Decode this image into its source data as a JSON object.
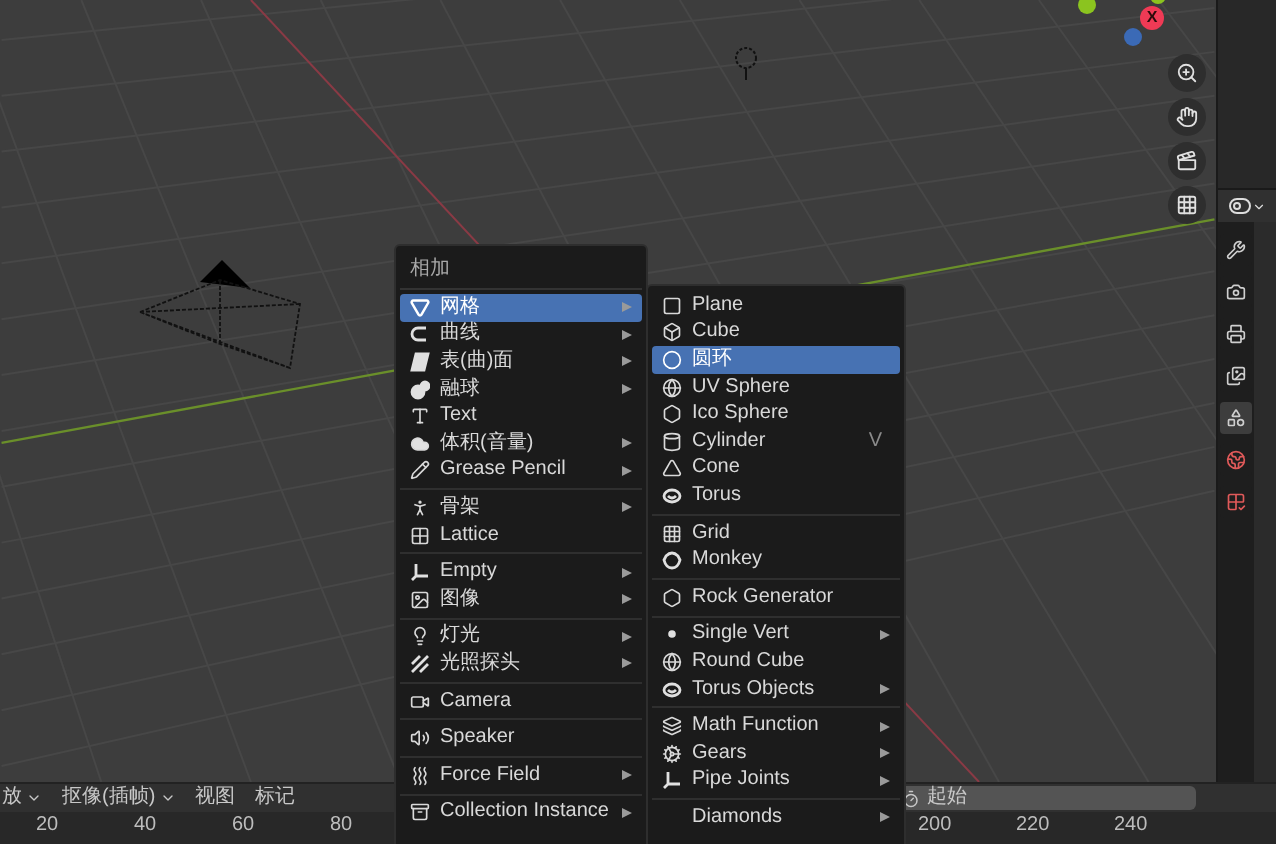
{
  "viewport": {
    "gizmo_x_label": "X"
  },
  "add_menu": {
    "title": "相加",
    "groups": [
      [
        {
          "label": "网格",
          "submenu": true,
          "selected": true
        },
        {
          "label": "曲线",
          "submenu": true,
          "selected": false
        },
        {
          "label": "表(曲)面",
          "submenu": true,
          "selected": false
        },
        {
          "label": "融球",
          "submenu": true,
          "selected": false
        },
        {
          "label": "Text",
          "submenu": false,
          "selected": false
        },
        {
          "label": "体积(音量)",
          "submenu": true,
          "selected": false
        },
        {
          "label": "Grease Pencil",
          "submenu": true,
          "selected": false
        }
      ],
      [
        {
          "label": "骨架",
          "submenu": true,
          "selected": false
        },
        {
          "label": "Lattice",
          "submenu": false,
          "selected": false
        }
      ],
      [
        {
          "label": "Empty",
          "submenu": true,
          "selected": false
        },
        {
          "label": "图像",
          "submenu": true,
          "selected": false
        }
      ],
      [
        {
          "label": "灯光",
          "submenu": true,
          "selected": false
        },
        {
          "label": "光照探头",
          "submenu": true,
          "selected": false
        }
      ],
      [
        {
          "label": "Camera",
          "submenu": false,
          "selected": false
        }
      ],
      [
        {
          "label": "Speaker",
          "submenu": false,
          "selected": false
        }
      ],
      [
        {
          "label": "Force Field",
          "submenu": true,
          "selected": false
        }
      ],
      [
        {
          "label": "Collection Instance",
          "submenu": true,
          "selected": false
        }
      ]
    ]
  },
  "mesh_submenu": {
    "groups": [
      [
        {
          "label": "Plane",
          "submenu": false,
          "selected": false
        },
        {
          "label": "Cube",
          "submenu": false,
          "selected": false
        },
        {
          "label": "圆环",
          "submenu": false,
          "selected": true
        },
        {
          "label": "UV Sphere",
          "submenu": false,
          "selected": false
        },
        {
          "label": "Ico Sphere",
          "submenu": false,
          "selected": false
        },
        {
          "label": "Cylinder",
          "submenu": false,
          "selected": false,
          "shortcut": "V"
        },
        {
          "label": "Cone",
          "submenu": false,
          "selected": false
        },
        {
          "label": "Torus",
          "submenu": false,
          "selected": false
        }
      ],
      [
        {
          "label": "Grid",
          "submenu": false,
          "selected": false
        },
        {
          "label": "Monkey",
          "submenu": false,
          "selected": false
        }
      ],
      [
        {
          "label": "Rock Generator",
          "submenu": false,
          "selected": false
        }
      ],
      [
        {
          "label": "Single Vert",
          "submenu": true,
          "selected": false
        },
        {
          "label": "Round Cube",
          "submenu": false,
          "selected": false
        },
        {
          "label": "Torus Objects",
          "submenu": true,
          "selected": false
        }
      ],
      [
        {
          "label": "Math Function",
          "submenu": true,
          "selected": false
        },
        {
          "label": "Gears",
          "submenu": true,
          "selected": false
        },
        {
          "label": "Pipe Joints",
          "submenu": true,
          "selected": false
        }
      ],
      [
        {
          "label": "Diamonds",
          "submenu": true,
          "selected": false
        }
      ]
    ]
  },
  "properties_tabs": [
    {
      "selected": false
    },
    {
      "selected": false
    },
    {
      "selected": false
    },
    {
      "selected": false
    },
    {
      "selected": true
    },
    {
      "selected": false
    },
    {
      "selected": false
    }
  ],
  "timeline": {
    "menus": [
      {
        "label": "放",
        "dropdown": true
      },
      {
        "label": "抠像(插帧)",
        "dropdown": true
      },
      {
        "label": "视图",
        "dropdown": false
      },
      {
        "label": "标记",
        "dropdown": false
      }
    ],
    "start_label": "起始",
    "ruler_ticks": [
      "20",
      "40",
      "60",
      "80",
      "200",
      "220",
      "240"
    ]
  }
}
